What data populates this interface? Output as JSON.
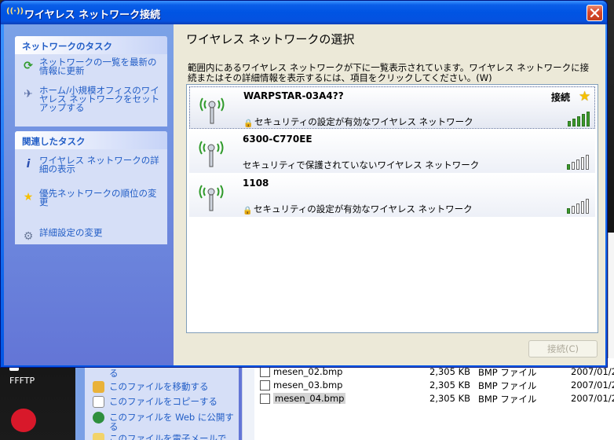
{
  "window": {
    "title": "ワイヤレス ネットワーク接続",
    "title_icon": "((·))"
  },
  "sidebar": {
    "network_tasks": {
      "header": "ネットワークのタスク",
      "items": [
        {
          "label": "ネットワークの一覧を最新の情報に更新",
          "icon": "refresh-icon"
        },
        {
          "label": "ホーム/小規模オフィスのワイヤレス ネットワークをセットアップする",
          "icon": "wireless-setup-icon"
        }
      ]
    },
    "related_tasks": {
      "header": "関連したタスク",
      "items": [
        {
          "label": "ワイヤレス ネットワークの詳細の表示",
          "icon": "info-icon"
        },
        {
          "label": "優先ネットワークの順位の変更",
          "icon": "star-icon"
        },
        {
          "label": "詳細設定の変更",
          "icon": "settings-icon"
        }
      ]
    }
  },
  "main": {
    "title": "ワイヤレス ネットワークの選択",
    "description": "範囲内にあるワイヤレス ネットワークが下に一覧表示されています。ワイヤレス ネットワークに接続またはその詳細情報を表示するには、項目をクリックしてください。(W)"
  },
  "networks": [
    {
      "ssid": "WARPSTAR-03A4??",
      "security": "セキュリティの設定が有効なワイヤレス ネットワーク",
      "secured": true,
      "status": "接続",
      "preferred": true,
      "signal_bars": 5
    },
    {
      "ssid": "6300-C770EE",
      "security": "セキュリティで保護されていないワイヤレス ネットワーク",
      "secured": false,
      "status": "",
      "preferred": false,
      "signal_bars": 1
    },
    {
      "ssid": "1108",
      "security": "セキュリティの設定が有効なワイヤレス ネットワーク",
      "secured": true,
      "status": "",
      "preferred": false,
      "signal_bars": 1
    }
  ],
  "buttons": {
    "connect": "接続(C)"
  },
  "background": {
    "desktop_icons": [
      {
        "label": "FFFTP"
      }
    ],
    "explorer_tasks": [
      {
        "label": "る"
      },
      {
        "label": "このファイルを移動する"
      },
      {
        "label": "このファイルをコピーする"
      },
      {
        "label": "このファイルを Web に公開す"
      },
      {
        "label": "る"
      },
      {
        "label": "このファイルを電子メールで"
      }
    ],
    "files": [
      {
        "name": "mesen_02.bmp",
        "size": "2,305 KB",
        "type": "BMP ファイル",
        "date": "2007/01/2"
      },
      {
        "name": "mesen_03.bmp",
        "size": "2,305 KB",
        "type": "BMP ファイル",
        "date": "2007/01/2"
      },
      {
        "name": "mesen_04.bmp",
        "size": "2,305 KB",
        "type": "BMP ファイル",
        "date": "2007/01/2"
      }
    ]
  },
  "colors": {
    "titlebar": "#0054e3",
    "task_link": "#215dc6",
    "signal_on": "#3c9b2c",
    "close": "#d8462a"
  }
}
